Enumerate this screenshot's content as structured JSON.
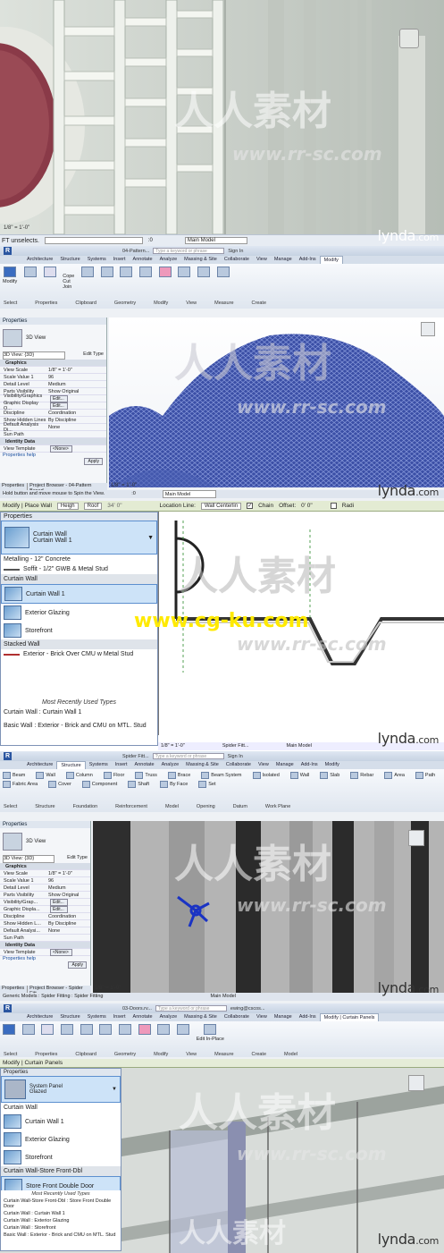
{
  "brand": {
    "lynda": "lynda",
    "lynda_suffix": ".com"
  },
  "watermark": {
    "cn": "人人素材",
    "url1": "www.rr-sc.com",
    "url2": "www.cg-ku.com"
  },
  "frame1": {
    "scale": "1/8\" = 1'-0\"",
    "status": "FT unselects.",
    "model": "Main Model",
    "zero": ":0"
  },
  "frame2": {
    "title": "04-Pattern...",
    "search": "Type a keyword or phrase",
    "user": "Sign In",
    "tabs": [
      "Architecture",
      "Structure",
      "Systems",
      "Insert",
      "Annotate",
      "Analyze",
      "Massing & Site",
      "Collaborate",
      "View",
      "Manage",
      "Add-Ins",
      "Modify"
    ],
    "active_tab": "Modify",
    "groups": [
      "Select",
      "Properties",
      "Clipboard",
      "Geometry",
      "Modify",
      "View",
      "Measure",
      "Create"
    ],
    "clip": [
      "Cope",
      "Cut",
      "Join"
    ],
    "props": {
      "header": "Properties",
      "type": "3D View",
      "instance": "3D View: {3D}",
      "edit_type": "Edit Type",
      "rows": [
        [
          "Graphics",
          ""
        ],
        [
          "View Scale",
          "1/8\" = 1'-0\""
        ],
        [
          "Scale Value 1",
          "96"
        ],
        [
          "Detail Level",
          "Medium"
        ],
        [
          "Parts Visibility",
          "Show Original"
        ],
        [
          "Visibility/Graphics ...",
          "Edit..."
        ],
        [
          "Graphic Display O...",
          "Edit..."
        ],
        [
          "Discipline",
          "Coordination"
        ],
        [
          "Show Hidden Lines",
          "By Discipline"
        ],
        [
          "Default Analysis Di...",
          "None"
        ],
        [
          "Sun Path",
          ""
        ],
        [
          "Identity Data",
          ""
        ],
        [
          "View Template",
          "<None>"
        ]
      ],
      "help": "Properties help",
      "apply": "Apply",
      "tabs": [
        "Properties",
        "Project Browser - 04-Pattern Based..."
      ]
    },
    "scale": "1/8\" = 1'-0\"",
    "status": "Hold button and move mouse to Spin the View.",
    "model": "Main Model",
    "zero": ":0"
  },
  "frame3": {
    "modify_label": "Modify | Place Wall",
    "height_label": "Heigh",
    "roof": "Roof",
    "offset_val": "34' 0\"",
    "location": "Location Line:",
    "location_val": "Wall Centerlin",
    "chain": "Chain",
    "offset": "Offset:",
    "offset_v": "0' 0\"",
    "radius": "Radi",
    "props_header": "Properties",
    "type_name": "Curtain Wall",
    "type_sub": "Curtain Wall 1",
    "items": [
      {
        "kind": "plain",
        "label": "Metalling - 12\" Concrete"
      },
      {
        "kind": "line",
        "label": "Soffit - 1/2\" GWB & Metal Stud"
      },
      {
        "kind": "cat",
        "label": "Curtain Wall"
      },
      {
        "kind": "sel",
        "label": "Curtain Wall 1"
      },
      {
        "kind": "sw",
        "label": "Exterior Glazing"
      },
      {
        "kind": "sw",
        "label": "Storefront"
      },
      {
        "kind": "cat",
        "label": "Stacked Wall"
      },
      {
        "kind": "line",
        "label": "Exterior - Brick Over CMU w Metal Stud"
      }
    ],
    "recent": "Most Recently Used Types",
    "recent_items": [
      "Curtain Wall : Curtain Wall 1",
      "Basic Wall : Exterior - Brick and CMU on MTL. Stud"
    ],
    "scale": "1/8\" = 1'-0\"",
    "model": "Main Model",
    "title": "Spider Fitt..."
  },
  "frame4": {
    "title": "Spider Fitt...",
    "search": "Type a keyword or phrase",
    "user": "Sign In",
    "tabs": [
      "Architecture",
      "Structure",
      "Systems",
      "Insert",
      "Annotate",
      "Analyze",
      "Massing & Site",
      "Collaborate",
      "View",
      "Manage",
      "Add-Ins",
      "Modify"
    ],
    "active_tab": "Structure",
    "tools": [
      "Beam",
      "Wall",
      "Column",
      "Floor",
      "Truss",
      "Brace",
      "Beam System",
      "Isolated",
      "Wall",
      "Slab",
      "Rebar",
      "Area",
      "Path",
      "Fabric Area",
      "Cover",
      "Component",
      "Shaft",
      "By Face",
      "Set"
    ],
    "groups": [
      "Select",
      "Structure",
      "Foundation",
      "Reinforcement",
      "Model",
      "Opening",
      "Datum",
      "Work Plane"
    ],
    "props": {
      "header": "Properties",
      "type": "3D View",
      "instance": "3D View: {3D}",
      "edit_type": "Edit Type",
      "rows": [
        [
          "Graphics",
          ""
        ],
        [
          "View Scale",
          "1/8\" = 1'-0\""
        ],
        [
          "Scale Value 1",
          "96"
        ],
        [
          "Detail Level",
          "Medium"
        ],
        [
          "Parts Visibility",
          "Show Original"
        ],
        [
          "Visibility/Grap...",
          "Edit..."
        ],
        [
          "Graphic Displa...",
          "Edit..."
        ],
        [
          "Discipline",
          "Coordination"
        ],
        [
          "Show Hidden L...",
          "By Discipline"
        ],
        [
          "Default Analysi...",
          "None"
        ],
        [
          "Sun Path",
          ""
        ],
        [
          "Identity Data",
          ""
        ],
        [
          "View Template",
          "<None>"
        ]
      ],
      "help": "Properties help",
      "apply": "Apply",
      "tabs": [
        "Properties",
        "Project Browser - Spider Fitt..."
      ]
    },
    "scale": "1/8\" = 1'-0\"",
    "status": "Generic Models : Spider Fitting : Spider Fitting",
    "model": "Main Model"
  },
  "frame5": {
    "title": "03-Doors.rv...",
    "search": "Type a keyword or phrase",
    "user": "ewing@cscos...",
    "tabs": [
      "Architecture",
      "Structure",
      "Systems",
      "Insert",
      "Annotate",
      "Analyze",
      "Massing & Site",
      "Collaborate",
      "View",
      "Manage",
      "Add-Ins",
      "Modify | Curtain Panels"
    ],
    "active_tab": "Modify | Curtain Panels",
    "groups": [
      "Select",
      "Properties",
      "Clipboard",
      "Geometry",
      "Modify",
      "View",
      "Measure",
      "Create",
      "Model"
    ],
    "edit_in_place": "Edit In-Place",
    "modify_label": "Modify | Curtain Panels",
    "props_header": "Properties",
    "type_name": "System Panel",
    "type_sub": "Glazed",
    "items": [
      {
        "kind": "plain",
        "label": "Curtain Wall"
      },
      {
        "kind": "sw",
        "label": "Curtain Wall 1"
      },
      {
        "kind": "sw",
        "label": "Exterior Glazing"
      },
      {
        "kind": "sw",
        "label": "Storefront"
      },
      {
        "kind": "cat",
        "label": "Curtain Wall-Store Front-Dbl"
      },
      {
        "kind": "sel",
        "label": "Store Front Double Door"
      }
    ],
    "recent": "Most Recently Used Types",
    "recent_items": [
      "Curtain Wall-Store Front-Dbl : Store Front Double Door",
      "Curtain Wall : Curtain Wall 1",
      "Curtain Wall : Exterior Glazing",
      "Curtain Wall : Storefront",
      "Basic Wall : Exterior - Brick and CMU on MTL. Stud"
    ]
  }
}
